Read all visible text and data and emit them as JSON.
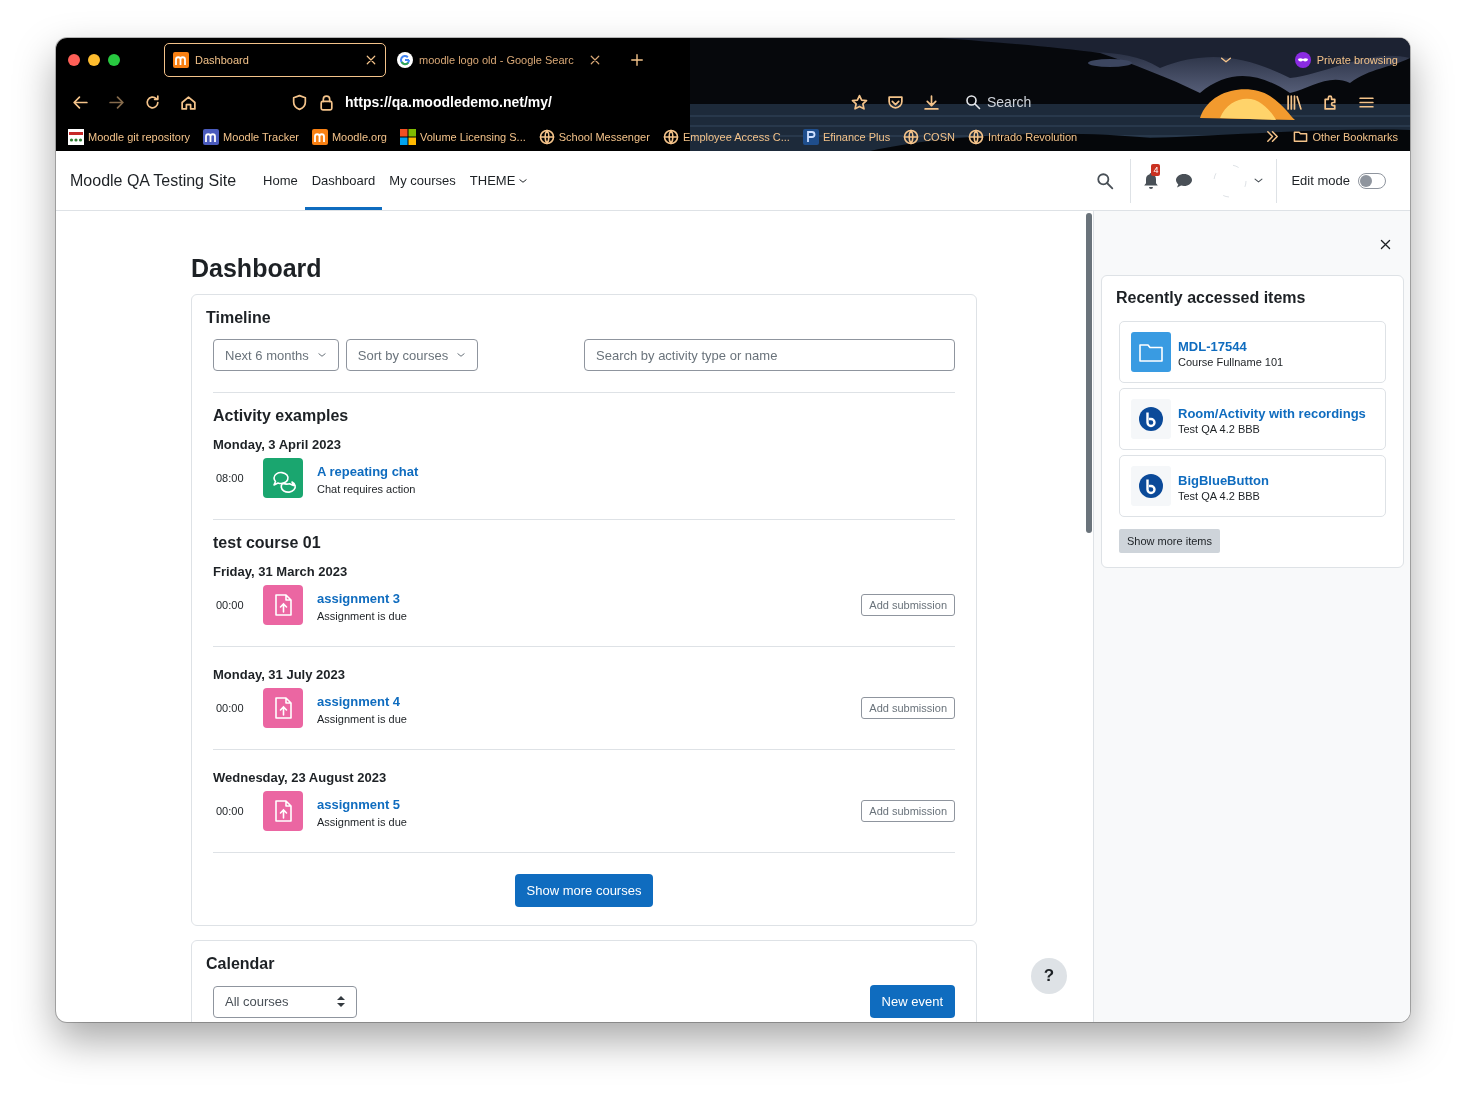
{
  "browser": {
    "tabs": [
      {
        "title": "Dashboard",
        "selected": true,
        "kind": "moodle"
      },
      {
        "title": "moodle logo old - Google Searc",
        "selected": false,
        "kind": "google"
      }
    ],
    "private_label": "Private browsing",
    "url": "https://qa.moodledemo.net/my/",
    "search_placeholder": "Search",
    "bookmarks": [
      {
        "label": "Moodle git repository",
        "kind": "git"
      },
      {
        "label": "Moodle Tracker",
        "kind": "tracker"
      },
      {
        "label": "Moodle.org",
        "kind": "moodle"
      },
      {
        "label": "Volume Licensing S...",
        "kind": "windows"
      },
      {
        "label": "School Messenger",
        "kind": "globe"
      },
      {
        "label": "Employee Access C...",
        "kind": "globe"
      },
      {
        "label": "Efinance Plus",
        "kind": "paypal"
      },
      {
        "label": "COSN",
        "kind": "globe"
      },
      {
        "label": "Intrado Revolution",
        "kind": "globe"
      }
    ],
    "other_bookmarks": "Other Bookmarks"
  },
  "navbar": {
    "site_name": "Moodle QA Testing Site",
    "items": [
      {
        "label": "Home",
        "selected": false,
        "dropdown": false
      },
      {
        "label": "Dashboard",
        "selected": true,
        "dropdown": false
      },
      {
        "label": "My courses",
        "selected": false,
        "dropdown": false
      },
      {
        "label": "THEME",
        "selected": false,
        "dropdown": true
      }
    ],
    "notification_count": "4",
    "edit_mode_label": "Edit mode",
    "edit_mode": false
  },
  "page_title": "Dashboard",
  "timeline": {
    "title": "Timeline",
    "filters": [
      "Next 6 months",
      "Sort by courses"
    ],
    "search_placeholder": "Search by activity type or name",
    "groups": [
      {
        "course": "Activity examples",
        "days": [
          {
            "date": "Monday, 3 April 2023",
            "events": [
              {
                "time": "08:00",
                "name": "A repeating chat",
                "status": "Chat requires action",
                "kind": "chat"
              }
            ]
          }
        ]
      },
      {
        "course": "test course 01",
        "days": [
          {
            "date": "Friday, 31 March 2023",
            "events": [
              {
                "time": "00:00",
                "name": "assignment 3",
                "status": "Assignment is due",
                "kind": "assignment",
                "action": "Add submission"
              }
            ]
          },
          {
            "date": "Monday, 31 July 2023",
            "events": [
              {
                "time": "00:00",
                "name": "assignment 4",
                "status": "Assignment is due",
                "kind": "assignment",
                "action": "Add submission"
              }
            ]
          },
          {
            "date": "Wednesday, 23 August 2023",
            "events": [
              {
                "time": "00:00",
                "name": "assignment 5",
                "status": "Assignment is due",
                "kind": "assignment",
                "action": "Add submission"
              }
            ]
          }
        ]
      }
    ],
    "more_button": "Show more courses"
  },
  "calendar": {
    "title": "Calendar",
    "course_select": "All courses",
    "new_event": "New event"
  },
  "help_button": "?",
  "drawer": {
    "title": "Recently accessed items",
    "items": [
      {
        "name": "MDL-17544",
        "course": "Course Fullname 101",
        "kind": "folder"
      },
      {
        "name": "Room/Activity with recordings",
        "course": "Test QA 4.2 BBB",
        "kind": "bigbluebutton"
      },
      {
        "name": "BigBlueButton",
        "course": "Test QA 4.2 BBB",
        "kind": "bigbluebutton"
      }
    ],
    "more_button": "Show more items"
  }
}
